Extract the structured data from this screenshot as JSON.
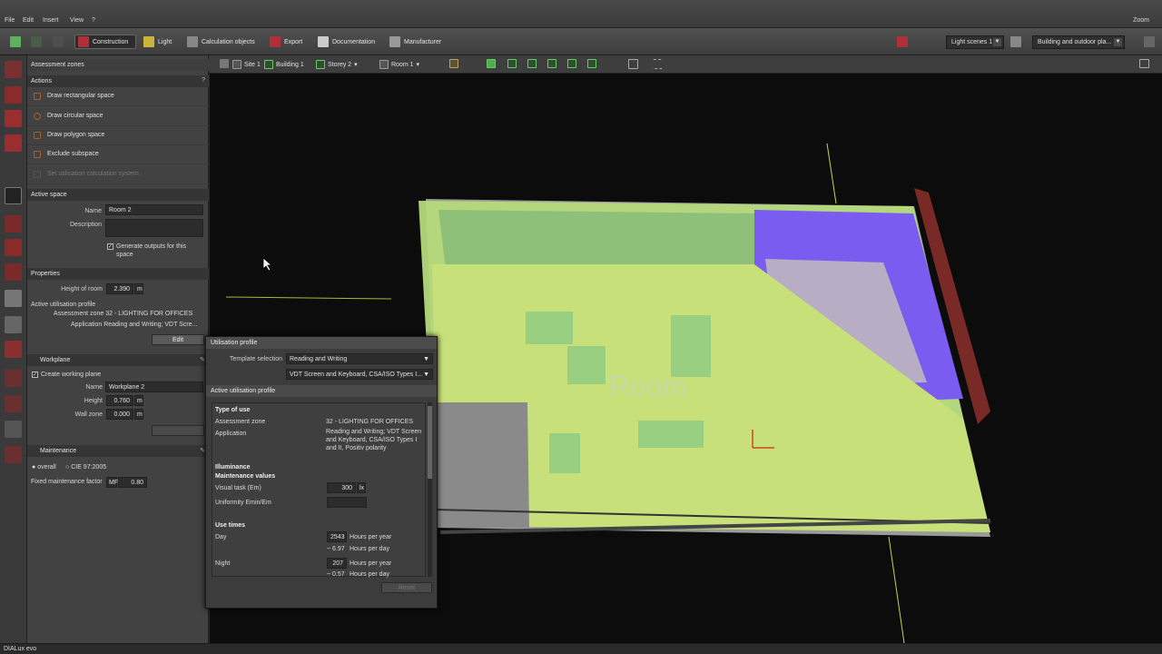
{
  "menu": [
    "File",
    "Edit",
    "Insert",
    "View",
    "?"
  ],
  "zoom_label": "Zoom",
  "toolbar": {
    "tabs": [
      "Construction",
      "Light",
      "Calculation objects",
      "Export",
      "Documentation",
      "Manufacturer"
    ],
    "light_scenes": "Light scenes 1",
    "building_plan": "Building and outdoor pla..."
  },
  "viewbar": {
    "crumbs": [
      "Site 1",
      "Building 1",
      "Storey 2",
      "Room 1"
    ]
  },
  "panel": {
    "header": "Assessment zones",
    "actions_title": "Actions",
    "help": "?",
    "actions": [
      "Draw rectangular space",
      "Draw circular space",
      "Draw polygon space",
      "Exclude subspace",
      "Set utilisation calculation system"
    ],
    "active_space_title": "Active space",
    "name_label": "Name",
    "name_value": "Room 2",
    "description_label": "Description",
    "generate_outputs": "Generate outputs for this space",
    "properties_title": "Properties",
    "height_label": "Height of room",
    "height_value": "2.390",
    "unit_m": "m",
    "active_utilisation_profile": "Active utilisation profile",
    "assessment_zone_line": "Assessment zone 32 - LIGHTING FOR OFFICES",
    "application_line": "Application Reading and Writing; VDT Scre...",
    "edit_button": "Edit",
    "workplane_title": "Workplane",
    "create_workplane": "Create working plane",
    "wp_name_label": "Name",
    "wp_name_value": "Workplane 2",
    "wp_height_label": "Height",
    "wp_height_value": "0.760",
    "wall_zone_label": "Wall zone",
    "wall_zone_value": "0.000",
    "maintenance_title": "Maintenance",
    "overall_label": "overall",
    "cie_label": "CIE 97:2005",
    "fixed_factor_label": "Fixed maintenance factor",
    "mf_label": "MF",
    "mf_value": "0.80"
  },
  "dialog": {
    "title": "Utilisation profile",
    "template_label": "Template selection",
    "template_value": "Reading and Writing",
    "template_value2": "VDT Screen and Keyboard, CSA/ISO Types I...",
    "section": "Active utilisation profile",
    "type_of_use": "Type of use",
    "assessment_zone_label": "Assessment zone",
    "assessment_zone_value": "32 - LIGHTING FOR OFFICES",
    "application_label": "Application",
    "application_value": "Reading and Writing; VDT Screen and Keyboard, CSA/ISO Types I and II, Positiv polarity",
    "illuminance": "Illuminance",
    "maintenance_values": "Maintenance values",
    "visual_task_label": "Visual task (Em)",
    "visual_task_value": "300",
    "lx": "lx",
    "uniformity_label": "Uniformity Emin/Em",
    "use_times": "Use times",
    "day_label": "Day",
    "day_value": "2543",
    "hours_per_year": "Hours per year",
    "day_approx": "~ 6.97",
    "hours_per_day": "Hours per day",
    "night_label": "Night",
    "night_value": "207",
    "night_approx": "~ 0.57",
    "reset_button": "Reset"
  },
  "viewport": {
    "room_label": "Room"
  },
  "status": "DIALux evo",
  "colors": {
    "accent": "#8fd96a",
    "purple": "#7a5cf0",
    "brick": "#8a3a34"
  }
}
